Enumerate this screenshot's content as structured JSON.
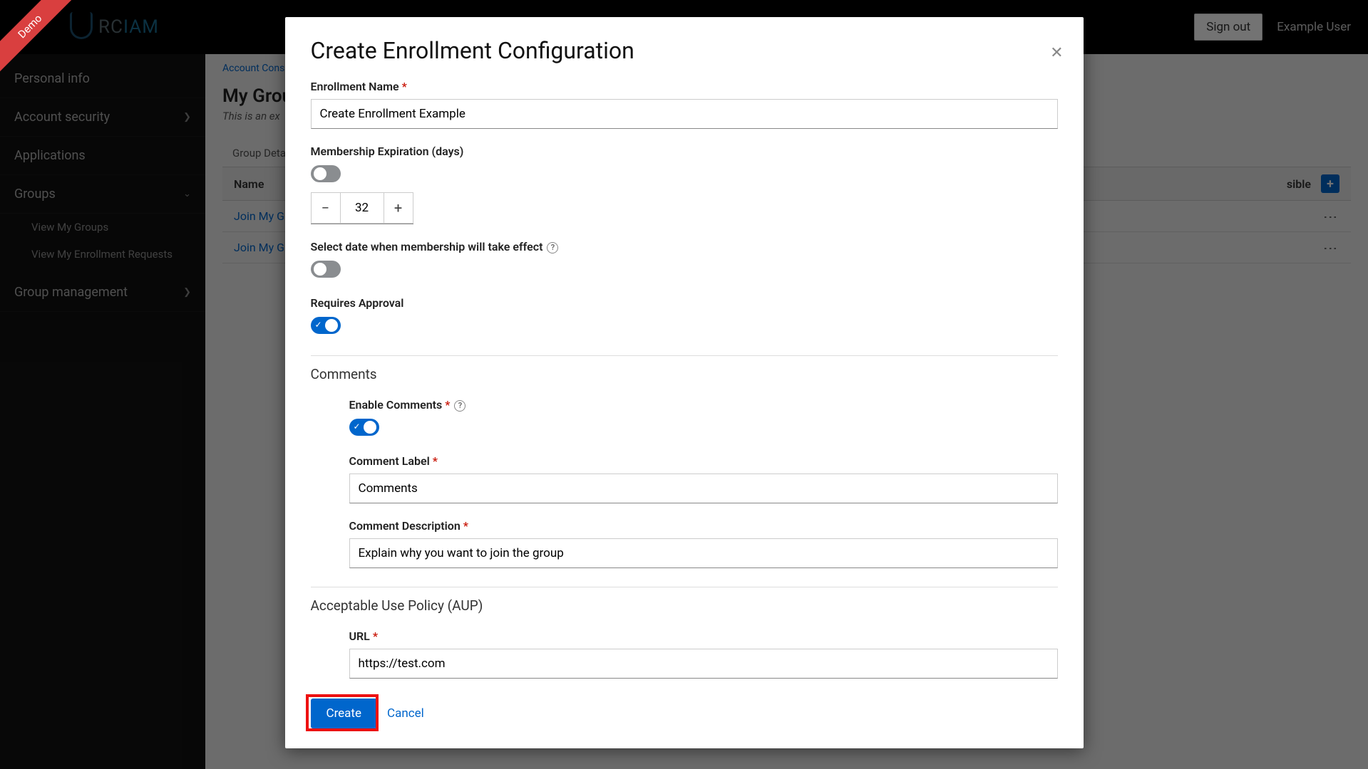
{
  "ribbon": "Demo",
  "logo": {
    "grey": "RC",
    "blue": "IAM"
  },
  "topbar": {
    "signout": "Sign out",
    "user": "Example User"
  },
  "sidebar": {
    "items": [
      {
        "label": "Personal info",
        "chevron": false
      },
      {
        "label": "Account security",
        "chevron": true
      },
      {
        "label": "Applications",
        "chevron": false
      },
      {
        "label": "Groups",
        "chevron": true,
        "expanded": true
      },
      {
        "label": "Group management",
        "chevron": true
      }
    ],
    "subitems": [
      "View My Groups",
      "View My Enrollment Requests"
    ]
  },
  "breadcrumb": "Account Conso",
  "page": {
    "title": "My Grou",
    "subtitle": "This is an ex"
  },
  "tab": "Group Details",
  "table": {
    "header_name": "Name",
    "header_vis": "sible",
    "rows": [
      "Join My Grou",
      "Join My Grou"
    ]
  },
  "modal": {
    "title": "Create Enrollment Configuration",
    "enrollment_name_label": "Enrollment Name",
    "enrollment_name_value": "Create Enrollment Example",
    "membership_exp_label": "Membership Expiration (days)",
    "membership_value": "32",
    "effect_date_label": "Select date when membership will take effect",
    "requires_approval_label": "Requires Approval",
    "comments_section": "Comments",
    "enable_comments_label": "Enable Comments",
    "comment_label_label": "Comment Label",
    "comment_label_value": "Comments",
    "comment_desc_label": "Comment Description",
    "comment_desc_value": "Explain why you want to join the group",
    "aup_section": "Acceptable Use Policy (AUP)",
    "url_label": "URL",
    "url_value": "https://test.com",
    "create": "Create",
    "cancel": "Cancel"
  }
}
